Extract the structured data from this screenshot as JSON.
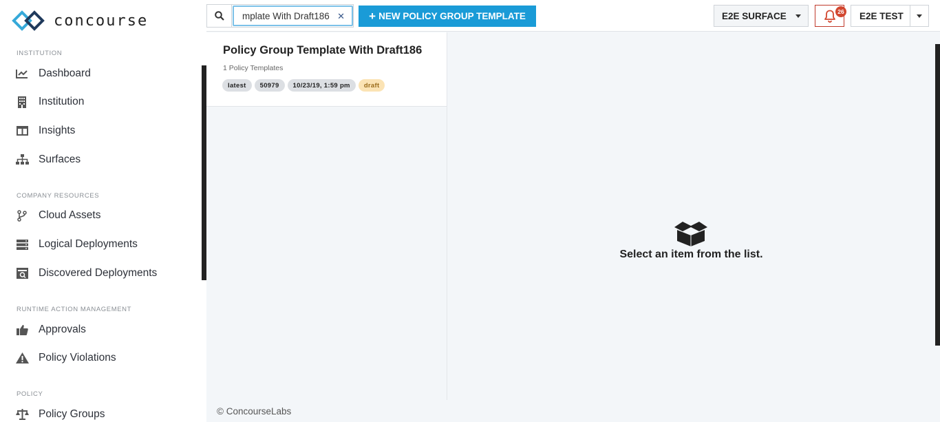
{
  "app": {
    "name": "concourse"
  },
  "sidebar": {
    "sections": [
      {
        "title": "INSTITUTION",
        "items": [
          {
            "label": "Dashboard",
            "icon": "chart-line-icon"
          },
          {
            "label": "Institution",
            "icon": "building-icon"
          },
          {
            "label": "Insights",
            "icon": "columns-icon"
          },
          {
            "label": "Surfaces",
            "icon": "sitemap-icon"
          }
        ]
      },
      {
        "title": "COMPANY RESOURCES",
        "items": [
          {
            "label": "Cloud Assets",
            "icon": "branch-icon"
          },
          {
            "label": "Logical Deployments",
            "icon": "server-icon"
          },
          {
            "label": "Discovered Deployments",
            "icon": "scan-icon"
          }
        ]
      },
      {
        "title": "RUNTIME ACTION MANAGEMENT",
        "items": [
          {
            "label": "Approvals",
            "icon": "thumbs-up-icon"
          },
          {
            "label": "Policy Violations",
            "icon": "warning-icon"
          }
        ]
      },
      {
        "title": "POLICY",
        "items": [
          {
            "label": "Policy Groups",
            "icon": "balance-scale-icon"
          }
        ]
      }
    ]
  },
  "topbar": {
    "search": {
      "value": "mplate With Draft186",
      "clear_glyph": "✕"
    },
    "new_button_label": "NEW POLICY GROUP TEMPLATE",
    "surface_label": "E2E SURFACE",
    "notifications_count": "26",
    "user_label": "E2E TEST"
  },
  "list": {
    "items": [
      {
        "title": "Policy Group Template With Draft186",
        "subtitle": "1 Policy Templates",
        "tags": [
          "latest",
          "50979",
          "10/23/19, 1:59 pm",
          "draft"
        ]
      }
    ]
  },
  "detail": {
    "empty_message": "Select an item from the list."
  },
  "footer": {
    "copyright": "© ConcourseLabs"
  },
  "colors": {
    "accent": "#1a9bd7",
    "notification": "#d2472f",
    "draft_tag_bg": "#fbe3b4",
    "page_bg": "#f3f6f9"
  }
}
